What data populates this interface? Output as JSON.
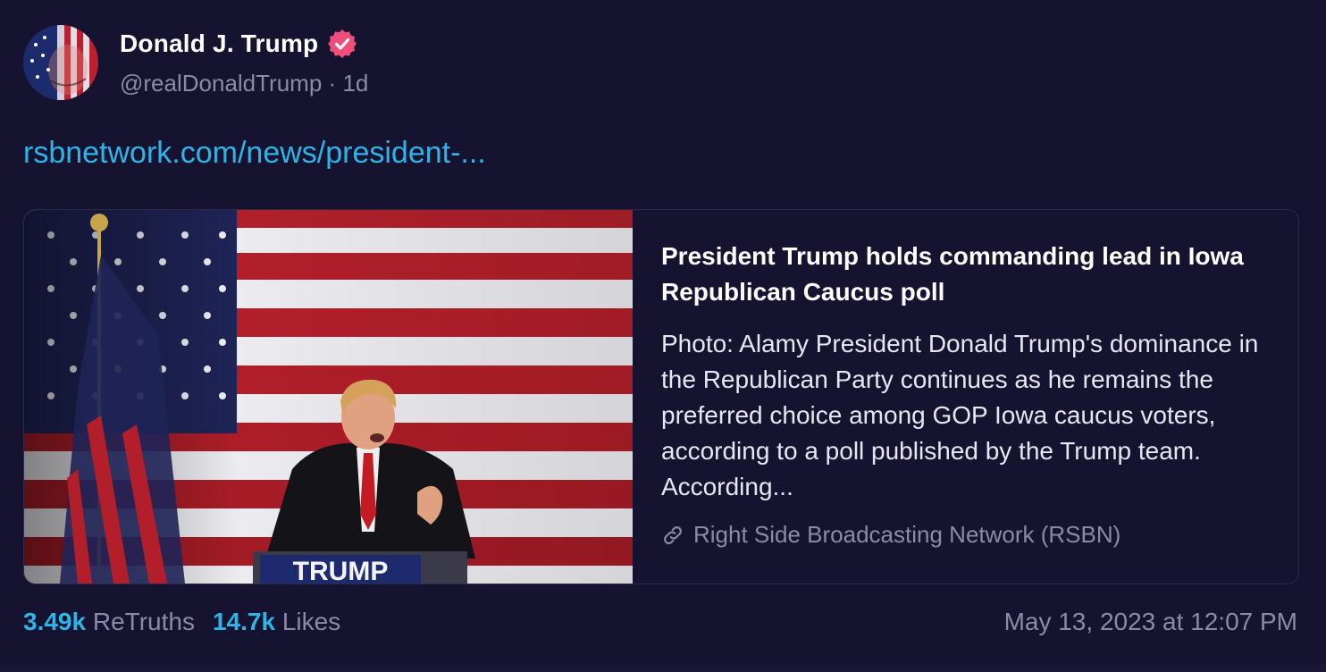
{
  "author": {
    "display_name": "Donald J. Trump",
    "handle": "@realDonaldTrump",
    "age": "1d",
    "separator": "·",
    "verified_color": "#f04e7a"
  },
  "post": {
    "link_text": "rsbnetwork.com/news/president-..."
  },
  "card": {
    "title": "President Trump holds commanding lead in Iowa Republican Caucus poll",
    "description": "Photo: Alamy President Donald Trump's dominance in the Republican Party continues as he remains the preferred choice among GOP Iowa caucus voters, according to a poll published by the Trump team. According...",
    "source": "Right Side Broadcasting Network (RSBN)",
    "source_icon": "link-icon",
    "image_podium_text": "TRUMP"
  },
  "stats": {
    "retruths_count": "3.49k",
    "retruths_label": "ReTruths",
    "likes_count": "14.7k",
    "likes_label": "Likes"
  },
  "timestamp": "May 13, 2023 at 12:07 PM",
  "colors": {
    "background": "#15132f",
    "accent": "#2fb4e8",
    "muted": "#8c8ba3"
  }
}
